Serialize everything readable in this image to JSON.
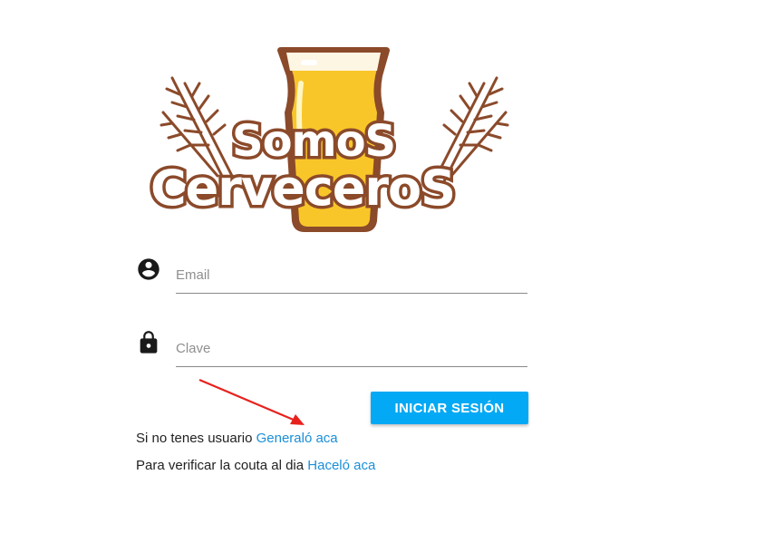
{
  "logo": {
    "line1": "SomoS",
    "line2": "CerveceroS",
    "colors": {
      "beer": "#f9c62a",
      "foam": "#fdf6e3",
      "outline": "#8b4a2a",
      "text": "#ffffff"
    }
  },
  "form": {
    "email": {
      "placeholder": "Email",
      "value": "",
      "icon": "account-circle-icon"
    },
    "password": {
      "placeholder": "Clave",
      "value": "",
      "icon": "lock-icon"
    },
    "submit_label": "INICIAR SESIÓN"
  },
  "links": {
    "register_text": "Si no tenes usuario",
    "register_link": "Generaló aca",
    "verify_text": "Para verificar la couta al dia",
    "verify_link": "Haceló aca"
  },
  "colors": {
    "accent": "#03a9f4",
    "link": "#1a8fd8",
    "annotation_arrow": "#e8211d"
  }
}
